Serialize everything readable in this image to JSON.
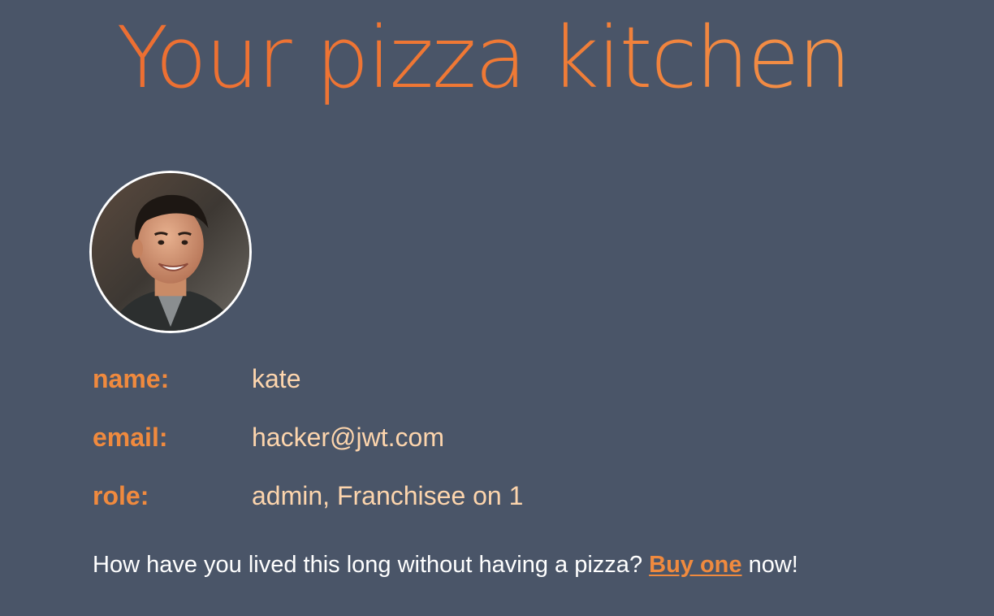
{
  "header": {
    "title": "Your pizza kitchen"
  },
  "profile": {
    "avatar_alt": "user avatar photo",
    "fields": [
      {
        "label": "name:",
        "value": "kate"
      },
      {
        "label": "email:",
        "value": "hacker@jwt.com"
      },
      {
        "label": "role:",
        "value": "admin, Franchisee on 1"
      }
    ]
  },
  "promo": {
    "text_before": "How have you lived this long without having a pizza? ",
    "link_label": "Buy one",
    "text_after": " now!"
  },
  "colors": {
    "background": "#4a5568",
    "accent": "#f08a3e",
    "value_text": "#fdd5ad"
  }
}
